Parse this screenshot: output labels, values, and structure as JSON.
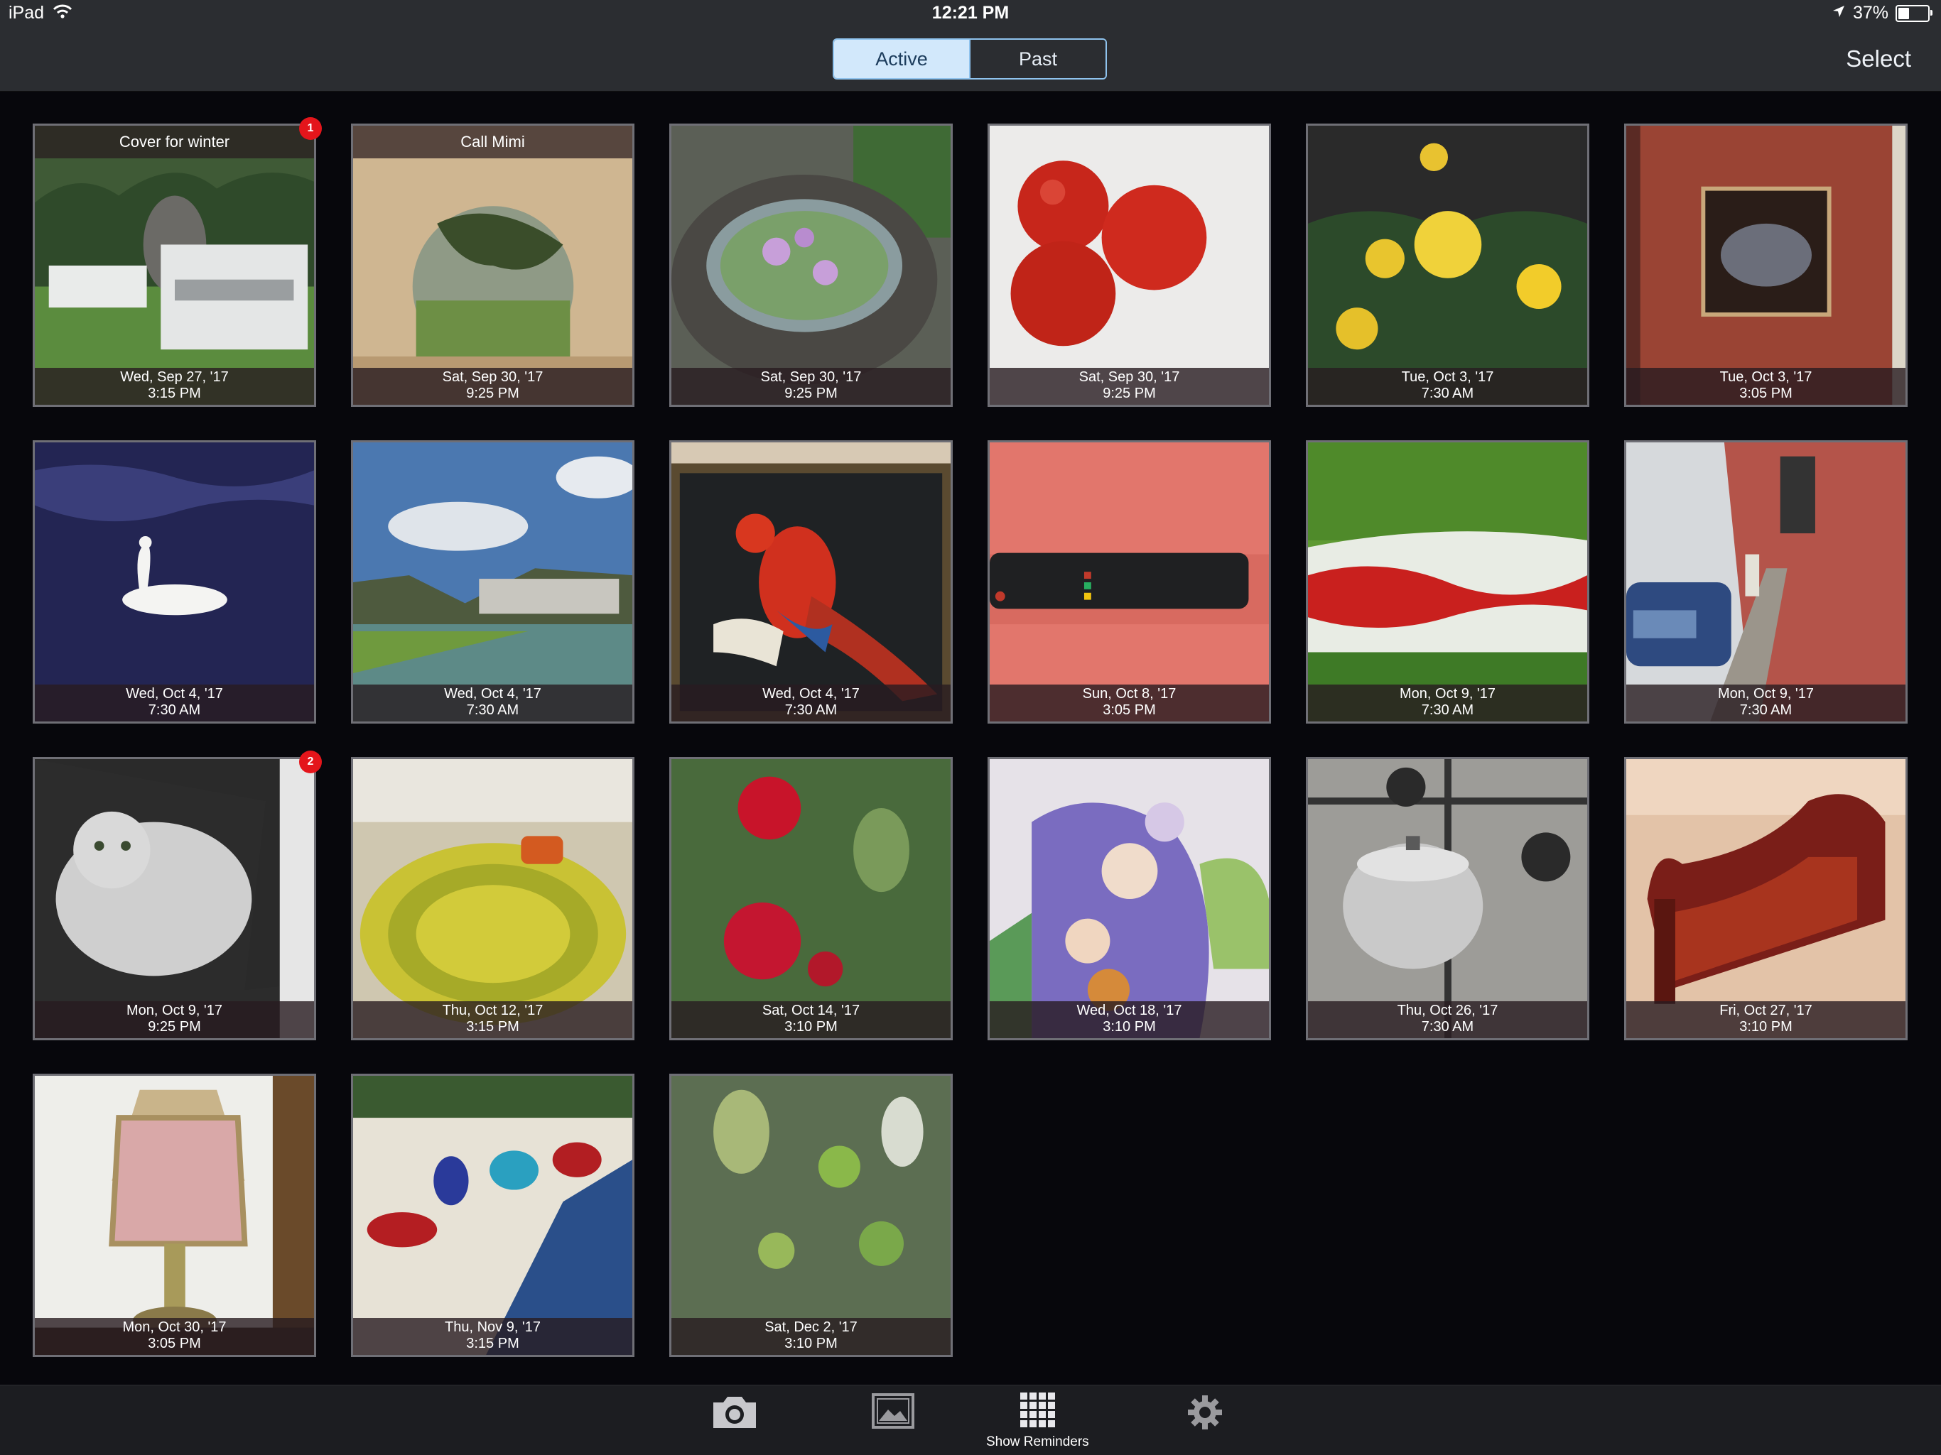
{
  "status_bar": {
    "device": "iPad",
    "time": "12:21 PM",
    "battery": "37%",
    "battery_level": 0.37
  },
  "segmented": {
    "active": "Active",
    "past": "Past"
  },
  "nav": {
    "select": "Select"
  },
  "tiles": [
    {
      "title": "Cover for winter",
      "badge": "1",
      "date": "Wed, Sep 27, '17",
      "time": "3:15 PM"
    },
    {
      "title": "Call Mimi",
      "date": "Sat, Sep 30, '17",
      "time": "9:25 PM"
    },
    {
      "date": "Sat, Sep 30, '17",
      "time": "9:25 PM"
    },
    {
      "date": "Sat, Sep 30, '17",
      "time": "9:25 PM"
    },
    {
      "date": "Tue, Oct 3, '17",
      "time": "7:30 AM"
    },
    {
      "date": "Tue, Oct 3, '17",
      "time": "3:05 PM"
    },
    {
      "date": "Wed, Oct 4, '17",
      "time": "7:30 AM"
    },
    {
      "date": "Wed, Oct 4, '17",
      "time": "7:30 AM"
    },
    {
      "date": "Wed, Oct 4, '17",
      "time": "7:30 AM"
    },
    {
      "date": "Sun, Oct 8, '17",
      "time": "3:05 PM"
    },
    {
      "date": "Mon, Oct 9, '17",
      "time": "7:30 AM"
    },
    {
      "date": "Mon, Oct 9, '17",
      "time": "7:30 AM"
    },
    {
      "badge": "2",
      "date": "Mon, Oct 9, '17",
      "time": "9:25 PM"
    },
    {
      "date": "Thu, Oct 12, '17",
      "time": "3:15 PM"
    },
    {
      "date": "Sat, Oct 14, '17",
      "time": "3:10 PM"
    },
    {
      "date": "Wed, Oct 18, '17",
      "time": "3:10 PM"
    },
    {
      "date": "Thu, Oct 26, '17",
      "time": "7:30 AM"
    },
    {
      "date": "Fri, Oct 27, '17",
      "time": "3:10 PM"
    },
    {
      "date": "Mon, Oct 30, '17",
      "time": "3:05 PM"
    },
    {
      "date": "Thu, Nov 9, '17",
      "time": "3:15 PM"
    },
    {
      "date": "Sat, Dec 2, '17",
      "time": "3:10 PM"
    }
  ],
  "tabbar": {
    "show_reminders": "Show Reminders"
  },
  "icons": [
    "wifi-icon",
    "location-arrow-icon",
    "battery-icon",
    "camera-icon",
    "photo-library-icon",
    "grid-icon",
    "gear-icon"
  ]
}
